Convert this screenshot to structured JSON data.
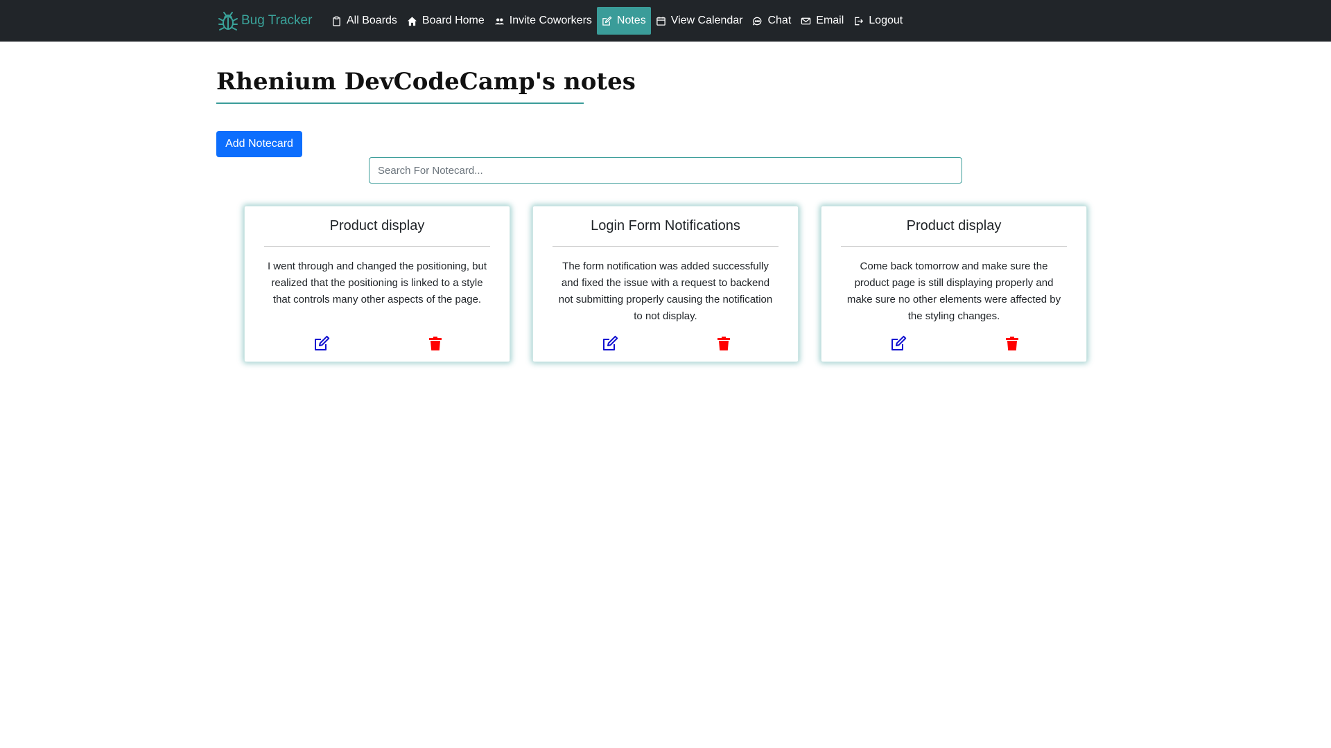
{
  "navbar": {
    "brand": "Bug Tracker",
    "links": [
      {
        "label": "All Boards",
        "icon": "clipboard-icon"
      },
      {
        "label": "Board Home",
        "icon": "home-icon"
      },
      {
        "label": "Invite Coworkers",
        "icon": "people-icon"
      },
      {
        "label": "Notes",
        "icon": "edit-icon",
        "active": true
      },
      {
        "label": "View Calendar",
        "icon": "calendar-icon"
      },
      {
        "label": "Chat",
        "icon": "chat-icon"
      },
      {
        "label": "Email",
        "icon": "envelope-icon"
      },
      {
        "label": "Logout",
        "icon": "logout-icon"
      }
    ]
  },
  "page": {
    "title": "Rhenium DevCodeCamp's notes",
    "add_button": "Add Notecard",
    "search_placeholder": "Search For Notecard..."
  },
  "cards": [
    {
      "title": "Product display",
      "body": "I went through and changed the positioning, but realized that the positioning is linked to a style that controls many other aspects of the page."
    },
    {
      "title": "Login Form Notifications",
      "body": "The form notification was added successfully and fixed the issue with a request to backend not submitting properly causing the notification to not display."
    },
    {
      "title": "Product display",
      "body": "Come back tomorrow and make sure the product page is still displaying properly and make sure no other elements were affected by the styling changes."
    }
  ],
  "colors": {
    "navbar_bg": "#212529",
    "accent": "#3a9c99",
    "primary_button": "#0d6efd",
    "edit_icon": "#1010d0",
    "delete_icon": "#ff0000"
  }
}
